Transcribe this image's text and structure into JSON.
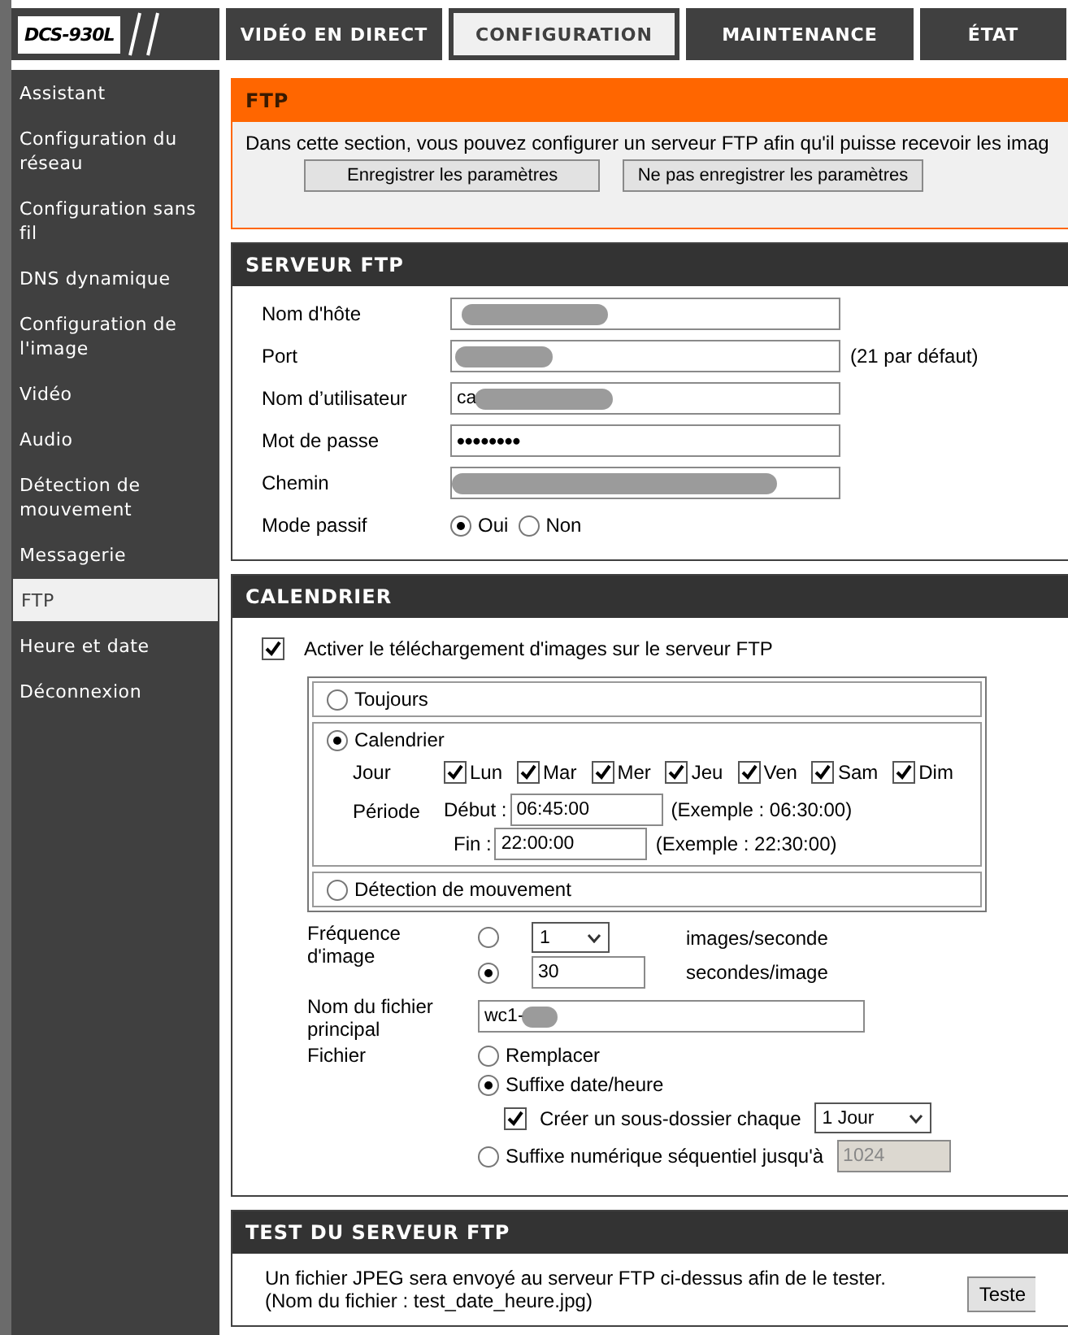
{
  "logo": {
    "model": "DCS-930L"
  },
  "tabs": [
    {
      "label": "VIDÉO EN DIRECT",
      "selected": false
    },
    {
      "label": "CONFIGURATION",
      "selected": true
    },
    {
      "label": "MAINTENANCE",
      "selected": false
    },
    {
      "label": "ÉTAT",
      "selected": false
    }
  ],
  "sidebar": {
    "items": [
      {
        "label": "Assistant",
        "selected": false
      },
      {
        "label": "Configuration du réseau",
        "selected": false
      },
      {
        "label": "Configuration sans fil",
        "selected": false
      },
      {
        "label": "DNS dynamique",
        "selected": false
      },
      {
        "label": "Configuration de l'image",
        "selected": false
      },
      {
        "label": "Vidéo",
        "selected": false
      },
      {
        "label": "Audio",
        "selected": false
      },
      {
        "label": "Détection de mouvement",
        "selected": false
      },
      {
        "label": "Messagerie",
        "selected": false
      },
      {
        "label": "FTP",
        "selected": true
      },
      {
        "label": "Heure et date",
        "selected": false
      },
      {
        "label": "Déconnexion",
        "selected": false
      }
    ]
  },
  "ftp_intro": {
    "title": "FTP",
    "text": "Dans cette section, vous pouvez configurer un serveur FTP afin qu'il puisse recevoir les imag",
    "buttons": [
      "Enregistrer les paramètres",
      "Ne pas enregistrer les paramètres"
    ]
  },
  "ftp_server": {
    "title": "SERVEUR FTP",
    "fields": [
      {
        "label": "Nom d'hôte",
        "redacted": true
      },
      {
        "label": "Port",
        "redacted": true,
        "hint": "(21 par défaut)"
      },
      {
        "label": "Nom d’utilisateur",
        "value": "ca",
        "redacted": true
      },
      {
        "label": "Mot de passe",
        "value": "••••••••"
      },
      {
        "label": "Chemin",
        "redacted": true
      }
    ],
    "passive_mode": {
      "label": "Mode passif",
      "options": [
        {
          "label": "Oui",
          "selected": true
        },
        {
          "label": "Non",
          "selected": false
        }
      ]
    }
  },
  "calendar": {
    "title": "CALENDRIER",
    "enable": {
      "label": "Activer le téléchargement d'images sur le serveur FTP",
      "checked": true
    },
    "modes": [
      {
        "kind": "simple",
        "label": "Toujours",
        "selected": false
      },
      {
        "kind": "schedule",
        "label": "Calendrier",
        "selected": true,
        "day_label": "Jour",
        "days": [
          {
            "label": "Lun",
            "checked": true
          },
          {
            "label": "Mar",
            "checked": true
          },
          {
            "label": "Mer",
            "checked": true
          },
          {
            "label": "Jeu",
            "checked": true
          },
          {
            "label": "Ven",
            "checked": true
          },
          {
            "label": "Sam",
            "checked": true
          },
          {
            "label": "Dim",
            "checked": true
          }
        ],
        "period_label": "Période",
        "start": {
          "label": "Début :",
          "value": "06:45:00",
          "example": "(Exemple : 06:30:00)"
        },
        "end": {
          "label": "Fin :",
          "value": "22:00:00",
          "example": "(Exemple : 22:30:00)"
        }
      },
      {
        "kind": "simple",
        "label": "Détection de mouvement",
        "selected": false
      }
    ],
    "frequency": {
      "label": "Fréquence d'image",
      "options": [
        {
          "kind": "select",
          "value": "1",
          "unit": "images/seconde",
          "selected": false
        },
        {
          "kind": "input",
          "value": "30",
          "unit": "secondes/image",
          "selected": true
        }
      ]
    },
    "base_filename": {
      "label": "Nom du fichier principal",
      "value": "wc1-",
      "redacted": true
    },
    "file": {
      "label": "Fichier",
      "options": [
        {
          "label": "Remplacer",
          "selected": false
        },
        {
          "label": "Suffixe date/heure",
          "selected": true,
          "subfolder": {
            "label": "Créer un sous-dossier chaque",
            "checked": true,
            "value": "1 Jour"
          }
        },
        {
          "label": "Suffixe numérique séquentiel jusqu'à",
          "selected": false,
          "limit": {
            "value": "1024",
            "disabled": true
          }
        }
      ]
    }
  },
  "test": {
    "title": "TEST DU SERVEUR FTP",
    "lines": [
      "Un fichier JPEG sera envoyé au serveur FTP ci-dessus afin de le tester.",
      "(Nom du fichier : test_date_heure.jpg)"
    ],
    "button": "Teste"
  }
}
